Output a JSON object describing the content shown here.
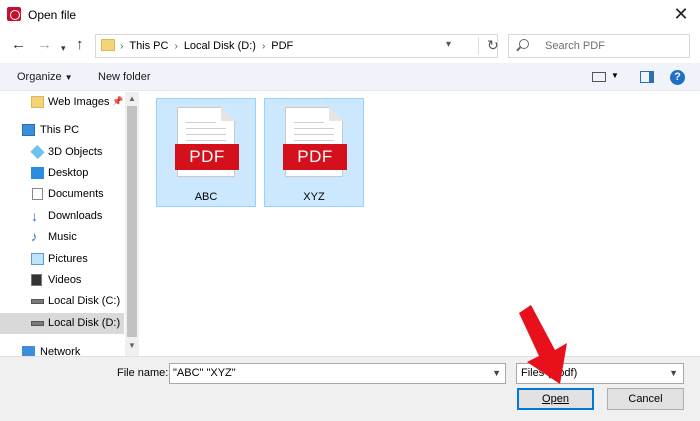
{
  "window": {
    "title": "Open file"
  },
  "address_bar": {
    "crumbs": [
      "This PC",
      "Local Disk (D:)",
      "PDF"
    ],
    "search_placeholder": "Search PDF"
  },
  "toolbar": {
    "organize_label": "Organize",
    "new_folder_label": "New folder"
  },
  "nav_pane": {
    "items": [
      {
        "label": "Web Images",
        "icon": "folder-icon"
      },
      {
        "label": "This PC",
        "icon": "computer-icon"
      },
      {
        "label": "3D Objects",
        "icon": "cube-icon"
      },
      {
        "label": "Desktop",
        "icon": "desktop-icon"
      },
      {
        "label": "Documents",
        "icon": "document-icon"
      },
      {
        "label": "Downloads",
        "icon": "download-icon"
      },
      {
        "label": "Music",
        "icon": "music-icon"
      },
      {
        "label": "Pictures",
        "icon": "picture-icon"
      },
      {
        "label": "Videos",
        "icon": "video-icon"
      },
      {
        "label": "Local Disk (C:)",
        "icon": "drive-icon"
      },
      {
        "label": "Local Disk (D:)",
        "icon": "drive-icon",
        "selected": true
      },
      {
        "label": "Network",
        "icon": "network-icon"
      }
    ]
  },
  "files": [
    {
      "name": "ABC",
      "badge": "PDF",
      "selected": true
    },
    {
      "name": "XYZ",
      "badge": "PDF",
      "selected": true
    }
  ],
  "bottom": {
    "file_name_label": "File name:",
    "file_name_value": "\"ABC\" \"XYZ\"",
    "file_type_value": "Files (*.pdf)",
    "open_label": "Open",
    "cancel_label": "Cancel"
  },
  "colors": {
    "accent": "#0078d7",
    "selection": "#cce8ff",
    "pdf_red": "#d5101d",
    "annotation_arrow": "#e8101a"
  }
}
